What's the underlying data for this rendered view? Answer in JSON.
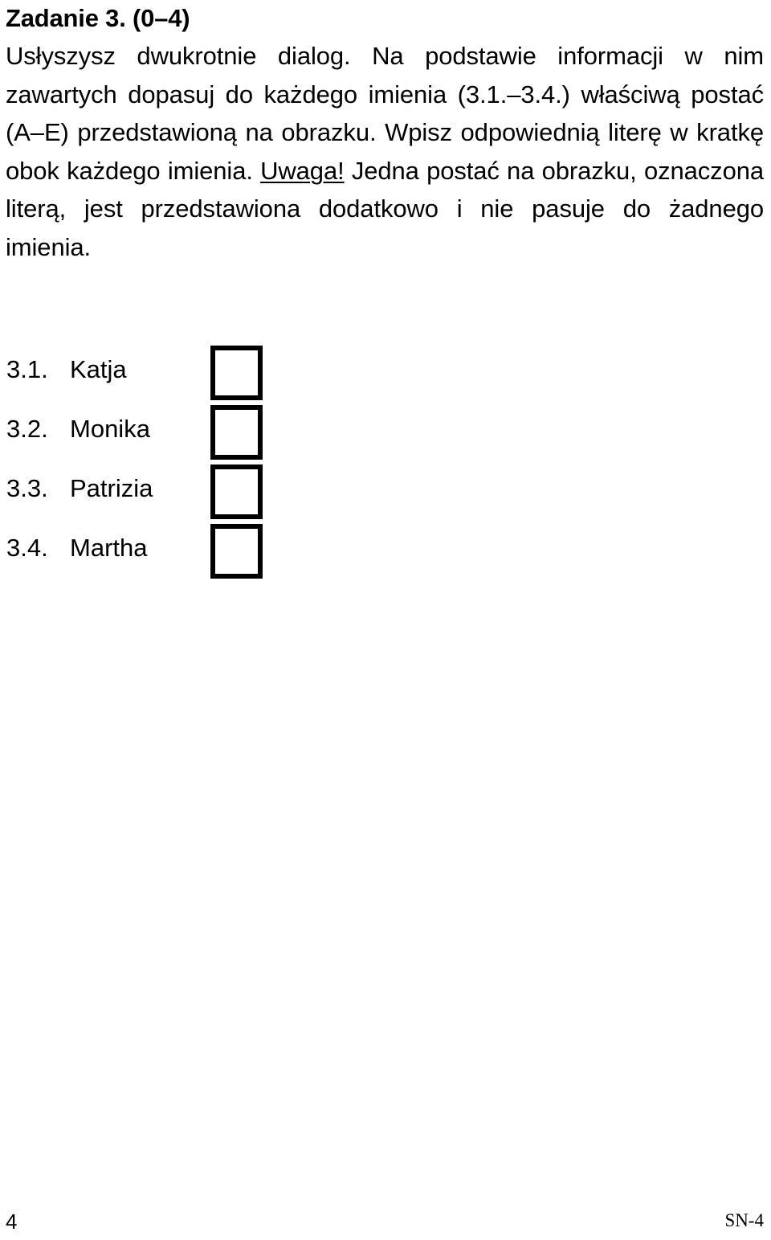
{
  "document": {
    "language": "pl",
    "task_title": "Zadanie 3. (0–4)",
    "instruction_lines": [
      "Usłyszysz dwukrotnie dialog.  Na podstawie informacji w nim",
      "zawartych dopasuj do każdego imienia (3.1.–3.4.) właściwą",
      "postać (A–E) przedstawioną na obrazku.  Wpisz odpowiednią",
      "literę w kratkę obok każdego imienia.  ",
      "obrazku, oznaczona literą, jest przedstawiona dodatkowo i nie",
      "pasuje do żadnego imienia."
    ],
    "instruction_emphasis": "Uwaga!",
    "instruction_after_emphasis": "  Jedna postać na",
    "instruction_full_text": "Usłyszysz dwukrotnie dialog.  Na podstawie informacji w nim zawartych dopasuj do każdego imienia (3.1.–3.4.) właściwą postać (A–E) przedstawioną na obrazku.  Wpisz odpowiednią literę w kratkę obok każdego imienia.  Uwaga!  Jedna postać na obrazku, oznaczona literą, jest przedstawiona dodatkowo i nie pasuje do żadnego imienia."
  },
  "answers": [
    {
      "number": "3.1.",
      "name": "Katja",
      "value": ""
    },
    {
      "number": "3.2.",
      "name": "Monika",
      "value": ""
    },
    {
      "number": "3.3.",
      "name": "Patrizia",
      "value": ""
    },
    {
      "number": "3.4.",
      "name": "Martha",
      "value": ""
    }
  ],
  "footer": {
    "page_number": "4",
    "exam_code": "SN-4"
  },
  "colors": {
    "text": "#000000",
    "background": "#ffffff",
    "box_border": "#000000"
  }
}
